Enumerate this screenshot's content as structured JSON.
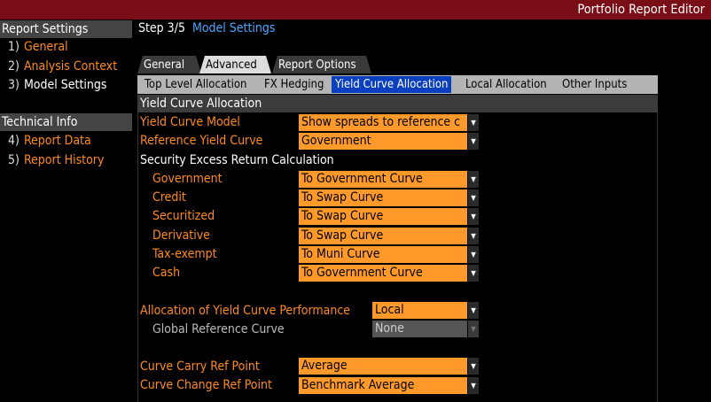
{
  "app": {
    "title": "Portfolio Report Editor"
  },
  "sidebar": {
    "report_settings_header": "Report Settings",
    "items": [
      {
        "num": "1)",
        "label": "General"
      },
      {
        "num": "2)",
        "label": "Analysis Context"
      },
      {
        "num": "3)",
        "label": "Model Settings"
      }
    ],
    "technical_header": "Technical Info",
    "tech_items": [
      {
        "num": "4)",
        "label": "Report Data"
      },
      {
        "num": "5)",
        "label": "Report History"
      }
    ]
  },
  "step": {
    "number": "Step 3/5",
    "title": "Model Settings"
  },
  "tabs": [
    {
      "label": "General"
    },
    {
      "label": "Advanced"
    },
    {
      "label": "Report Options"
    }
  ],
  "subtabs": [
    {
      "label": "Top Level Allocation"
    },
    {
      "label": "FX Hedging"
    },
    {
      "label": "Yield Curve Allocation"
    },
    {
      "label": "Local Allocation"
    },
    {
      "label": "Other Inputs"
    }
  ],
  "section": {
    "title": "Yield Curve Allocation"
  },
  "fields": {
    "yield_curve_model": {
      "label": "Yield Curve Model",
      "value": "Show spreads to reference c"
    },
    "reference_yield_curve": {
      "label": "Reference Yield Curve",
      "value": "Government"
    },
    "security_excess_header": "Security Excess Return Calculation",
    "government": {
      "label": "Government",
      "value": "To Government Curve"
    },
    "credit": {
      "label": "Credit",
      "value": "To Swap Curve"
    },
    "securitized": {
      "label": "Securitized",
      "value": "To Swap Curve"
    },
    "derivative": {
      "label": "Derivative",
      "value": "To Swap Curve"
    },
    "tax_exempt": {
      "label": "Tax-exempt",
      "value": "To Muni Curve"
    },
    "cash": {
      "label": "Cash",
      "value": "To Government Curve"
    },
    "allocation_perf": {
      "label": "Allocation of Yield Curve Performance",
      "value": "Local"
    },
    "global_ref_curve": {
      "label": "Global Reference Curve",
      "value": "None"
    },
    "curve_carry": {
      "label": "Curve Carry Ref Point",
      "value": "Average"
    },
    "curve_change": {
      "label": "Curve Change Ref Point",
      "value": "Benchmark Average"
    }
  },
  "colors": {
    "title_bar": "#7a0e17",
    "accent_orange": "#ff9a2a",
    "label_orange": "#ff8a1e",
    "step_blue": "#4da6ff",
    "active_subtab": "#0a3fbf"
  },
  "icons": {
    "dropdown_arrow": "dropdown-arrow-icon"
  }
}
